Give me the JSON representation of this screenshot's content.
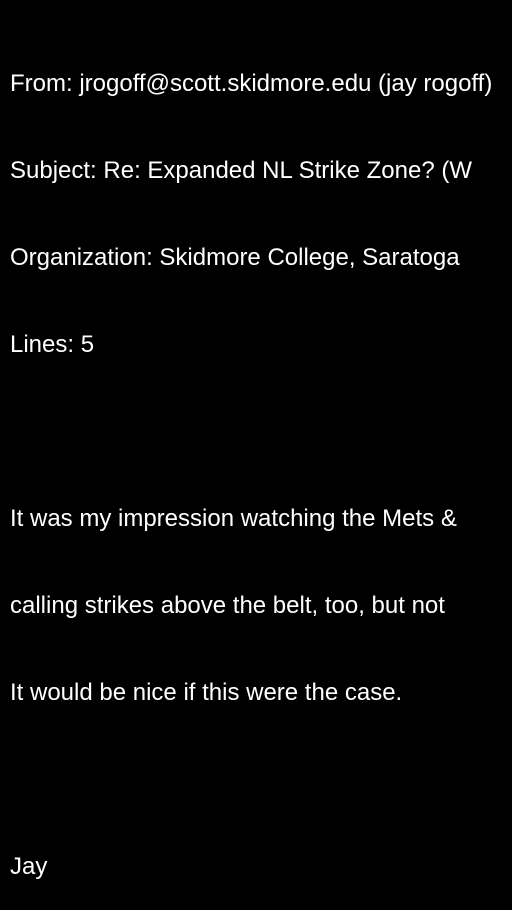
{
  "email": {
    "headers": {
      "from": "From: jrogoff@scott.skidmore.edu (jay rogoff)",
      "subject": "Subject: Re: Expanded NL Strike Zone? (W",
      "organization": "Organization: Skidmore College, Saratoga",
      "lines": "Lines: 5"
    },
    "body": {
      "line1": "It was my impression watching the Mets &",
      "line2": "calling strikes above the belt, too, but not",
      "line3": "It would be nice if this were the case.",
      "signature": "Jay"
    }
  },
  "colors": {
    "background": "#000000",
    "text": "#ffffff"
  }
}
